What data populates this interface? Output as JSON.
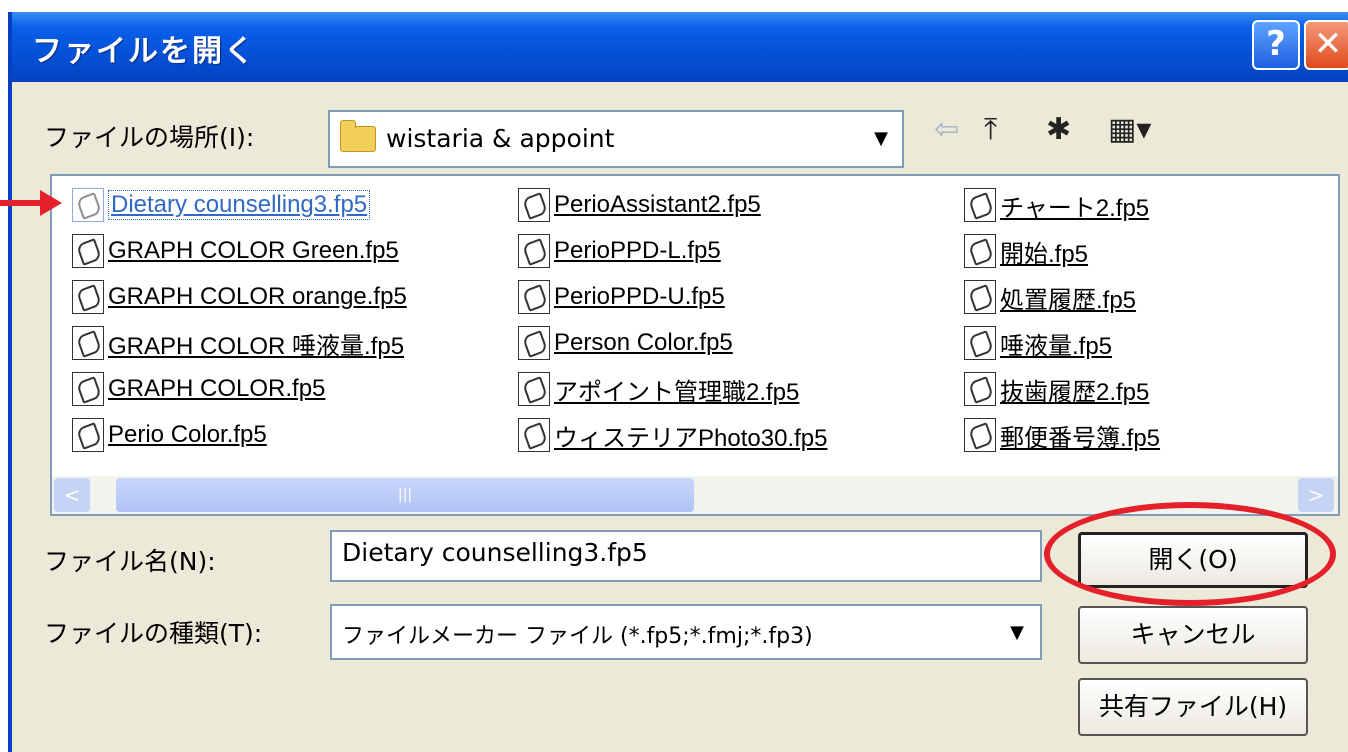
{
  "window": {
    "title": "ファイルを開く",
    "help_glyph": "?",
    "close_glyph": "✕"
  },
  "location": {
    "label": "ファイルの場所(I):",
    "value": "wistaria & appoint",
    "icons": [
      "folder-icon",
      "back-arrow-icon",
      "up-folder-icon",
      "new-folder-icon",
      "view-menu-icon"
    ]
  },
  "files": [
    {
      "name": "Dietary counselling3.fp5",
      "selected": true
    },
    {
      "name": "GRAPH COLOR Green.fp5"
    },
    {
      "name": "GRAPH COLOR orange.fp5"
    },
    {
      "name": "GRAPH COLOR 唾液量.fp5"
    },
    {
      "name": "GRAPH COLOR.fp5"
    },
    {
      "name": "Perio Color.fp5"
    },
    {
      "name": "PerioAssistant2.fp5"
    },
    {
      "name": "PerioPPD-L.fp5"
    },
    {
      "name": "PerioPPD-U.fp5"
    },
    {
      "name": "Person Color.fp5"
    },
    {
      "name": "アポイント管理職2.fp5"
    },
    {
      "name": "ウィステリアPhoto30.fp5"
    },
    {
      "name": "チャート2.fp5"
    },
    {
      "name": "開始.fp5"
    },
    {
      "name": "処置履歴.fp5"
    },
    {
      "name": "唾液量.fp5"
    },
    {
      "name": "抜歯履歴2.fp5"
    },
    {
      "name": "郵便番号簿.fp5"
    }
  ],
  "filename": {
    "label": "ファイル名(N):",
    "value": "Dietary counselling3.fp5"
  },
  "filetype": {
    "label": "ファイルの種類(T):",
    "value": "ファイルメーカー ファイル (*.fp5;*.fmj;*.fp3)"
  },
  "buttons": {
    "open": "開く(O)",
    "cancel": "キャンセル",
    "shared": "共有ファイル(H)"
  },
  "toolbar": {
    "back": "⇦",
    "up": "⤒",
    "new_folder": "✱",
    "view": "▦▾"
  },
  "scroll": {
    "left": "<",
    "right": ">",
    "thumb_grip": "|||"
  },
  "combo_arrow": "▼",
  "colors": {
    "titlebar": "#0551d8",
    "selection": "#316ac5",
    "annotation": "#e4202a"
  }
}
